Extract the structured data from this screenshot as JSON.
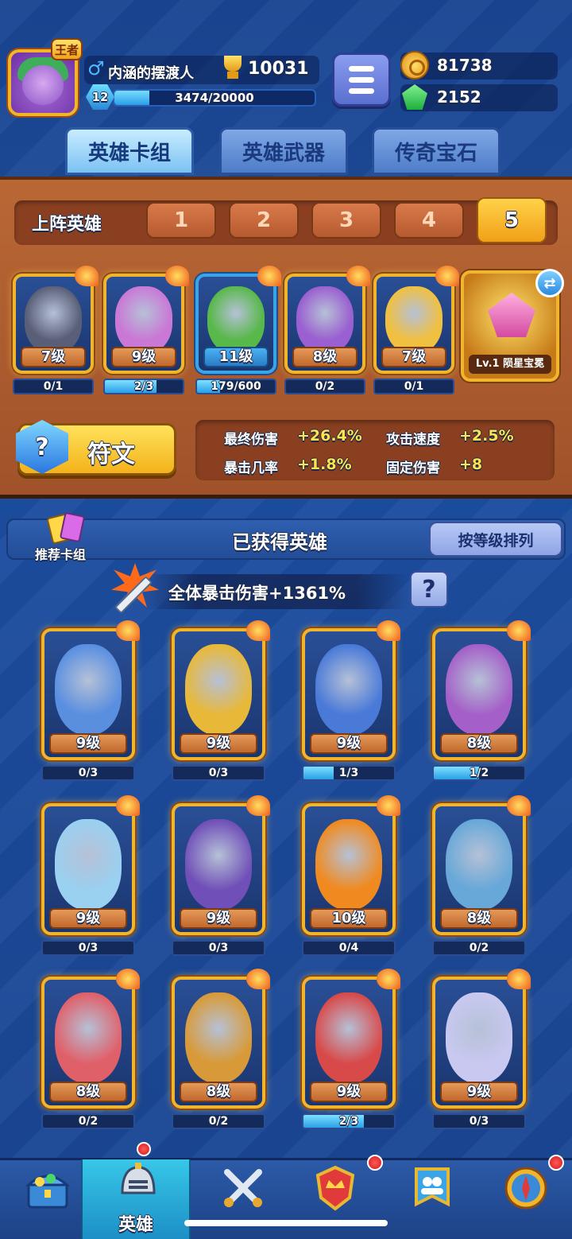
{
  "player": {
    "name": "内涵的摆渡人",
    "badge": "王者",
    "trophies": "10031",
    "level": "12",
    "exp_text": "3474/20000",
    "exp_fraction": 0.1737
  },
  "currencies": {
    "coins": "81738",
    "gems": "2152"
  },
  "tabs": [
    {
      "label": "英雄卡组",
      "active": true
    },
    {
      "label": "英雄武器",
      "active": false
    },
    {
      "label": "传奇宝石",
      "active": false
    }
  ],
  "team": {
    "title": "上阵英雄",
    "slots": [
      "1",
      "2",
      "3",
      "4",
      "5"
    ],
    "active_slot": "5",
    "heroes": [
      {
        "level": "7级",
        "progress": "0/1",
        "fraction": 0,
        "color": "#5a5f78"
      },
      {
        "level": "9级",
        "progress": "2/3",
        "fraction": 0.667,
        "color": "#c978d6"
      },
      {
        "level": "11级",
        "progress": "179/600",
        "fraction": 0.298,
        "color": "#58b84a"
      },
      {
        "level": "8级",
        "progress": "0/2",
        "fraction": 0,
        "color": "#9a5fd0"
      },
      {
        "level": "7级",
        "progress": "0/1",
        "fraction": 0,
        "color": "#f0c040"
      }
    ],
    "treasure_label": "Lv.1 陨星宝冕"
  },
  "rune": {
    "label": "符文"
  },
  "stats": {
    "final_damage_label": "最终伤害",
    "final_damage_value": "+26.4%",
    "attack_speed_label": "攻击速度",
    "attack_speed_value": "+2.5%",
    "crit_rate_label": "暴击几率",
    "crit_rate_value": "+1.8%",
    "fixed_damage_label": "固定伤害",
    "fixed_damage_value": "+8"
  },
  "owned": {
    "recommend_label": "推荐卡组",
    "title": "已获得英雄",
    "sort_label": "按等级排列",
    "crit_text": "全体暴击伤害+1361%",
    "help_label": "?",
    "heroes": [
      {
        "level": "9级",
        "progress": "0/3",
        "fraction": 0,
        "color": "#5a8fe0"
      },
      {
        "level": "9级",
        "progress": "0/3",
        "fraction": 0,
        "color": "#e8b838"
      },
      {
        "level": "9级",
        "progress": "1/3",
        "fraction": 0.333,
        "color": "#4a7ad8"
      },
      {
        "level": "8级",
        "progress": "1/2",
        "fraction": 0.5,
        "color": "#a460c8"
      },
      {
        "level": "9级",
        "progress": "0/3",
        "fraction": 0,
        "color": "#9ad0f0"
      },
      {
        "level": "9级",
        "progress": "0/3",
        "fraction": 0,
        "color": "#7050b8"
      },
      {
        "level": "10级",
        "progress": "0/4",
        "fraction": 0,
        "color": "#f08a20"
      },
      {
        "level": "8级",
        "progress": "0/2",
        "fraction": 0,
        "color": "#68a8d8"
      },
      {
        "level": "8级",
        "progress": "0/2",
        "fraction": 0,
        "color": "#e0606a"
      },
      {
        "level": "8级",
        "progress": "0/2",
        "fraction": 0,
        "color": "#d89a38"
      },
      {
        "level": "9级",
        "progress": "2/3",
        "fraction": 0.667,
        "color": "#d84a4a"
      },
      {
        "level": "9级",
        "progress": "0/3",
        "fraction": 0,
        "color": "#c8c8f0"
      }
    ]
  },
  "nav": {
    "active_label": "英雄"
  }
}
